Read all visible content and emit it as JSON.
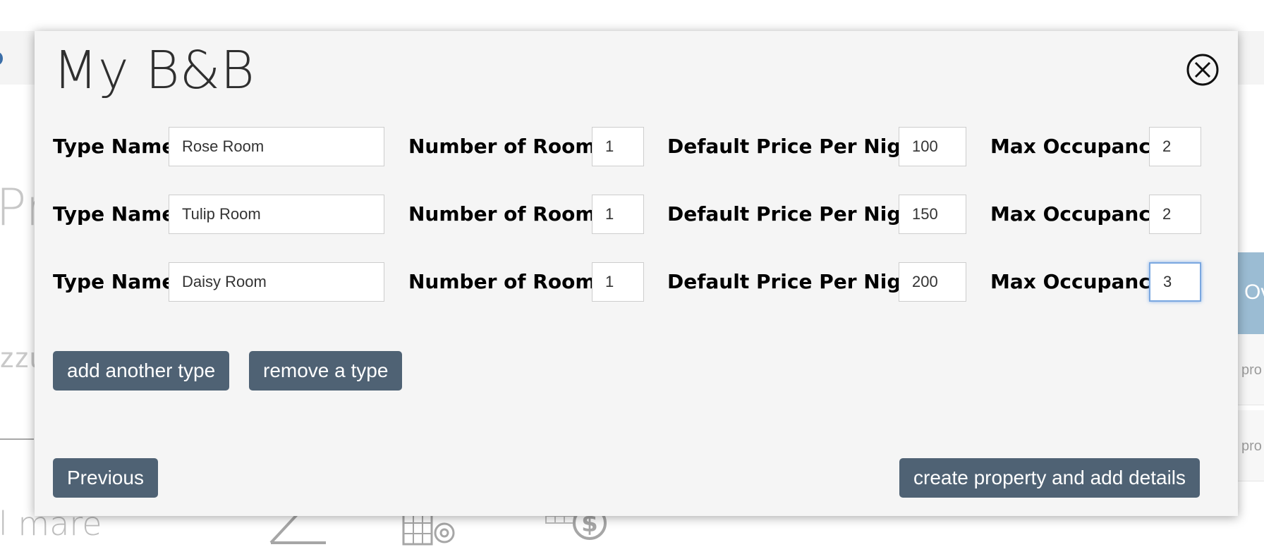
{
  "background": {
    "big_text": "Pr",
    "side_text": "zzu",
    "bottom_text": "l mare",
    "right_panel_text": "Ov",
    "right_row_1": "pro",
    "right_row_2": "pro"
  },
  "modal": {
    "title": "My B&B",
    "type_rows": [
      {
        "type_name_label": "Type Name",
        "type_name": "Rose Room",
        "rooms_label": "Number of Rooms",
        "rooms": "1",
        "price_label": "Default Price Per Night",
        "price": "100",
        "occupancy_label": "Max Occupancy",
        "occupancy": "2"
      },
      {
        "type_name_label": "Type Name",
        "type_name": "Tulip Room",
        "rooms_label": "Number of Rooms",
        "rooms": "1",
        "price_label": "Default Price Per Night",
        "price": "150",
        "occupancy_label": "Max Occupancy",
        "occupancy": "2"
      },
      {
        "type_name_label": "Type Name",
        "type_name": "Daisy Room",
        "rooms_label": "Number of Rooms",
        "rooms": "1",
        "price_label": "Default Price Per Night",
        "price": "200",
        "occupancy_label": "Max Occupancy",
        "occupancy": "3"
      }
    ],
    "add_type_label": "add another type",
    "remove_type_label": "remove a type",
    "previous_label": "Previous",
    "create_label": "create property and add details"
  },
  "colors": {
    "button_bg": "#4f6274",
    "modal_bg": "#f5f5f5",
    "focus_border": "#7aa7e0",
    "accent_blue": "#9bbcd3"
  },
  "icons": [
    "close-circle-icon",
    "pencil-icon",
    "grid-gear-icon",
    "grid-dollar-icon"
  ]
}
